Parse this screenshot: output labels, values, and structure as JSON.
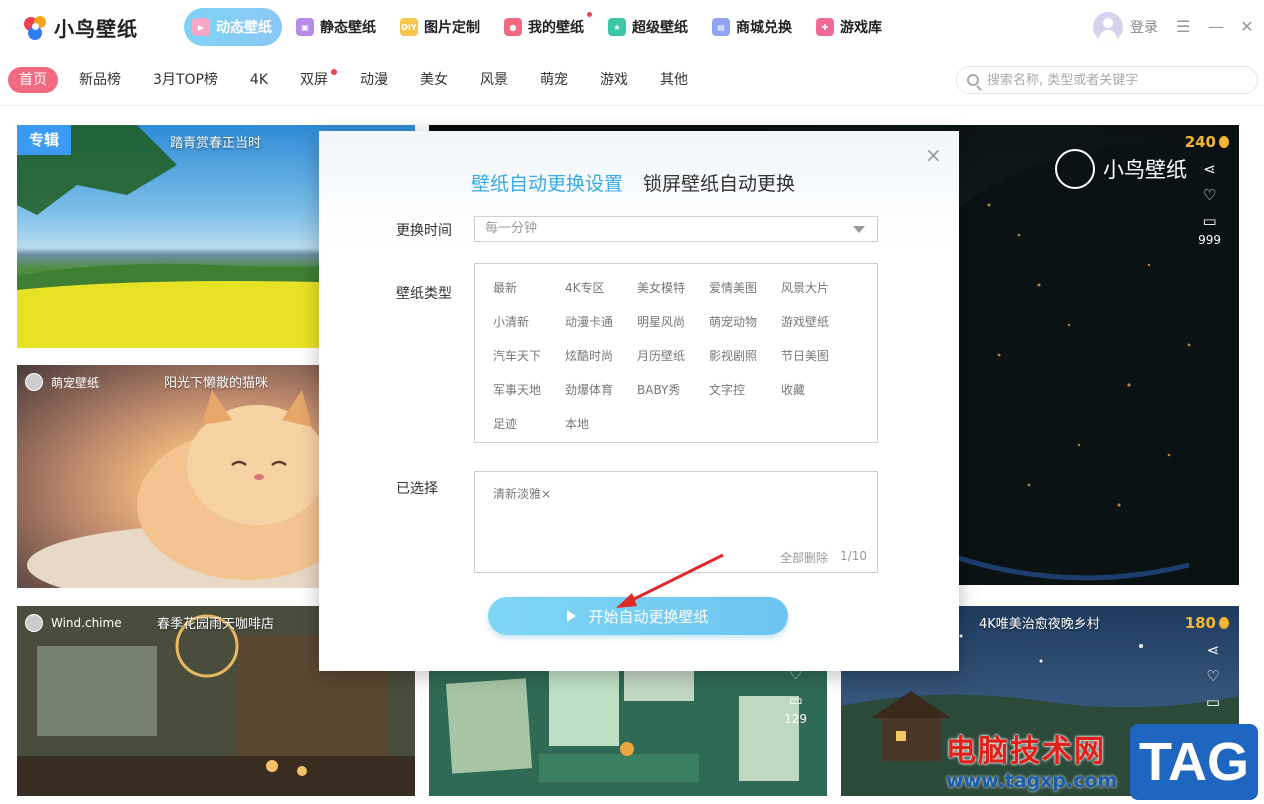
{
  "app": {
    "logo_text": "小鸟壁纸"
  },
  "nav": {
    "items": [
      {
        "label": "动态壁纸",
        "icon": "play-icon",
        "color": "#f16a7f"
      },
      {
        "label": "静态壁纸",
        "icon": "image-icon",
        "color": "#b78be8"
      },
      {
        "label": "图片定制",
        "icon": "diy-icon",
        "color": "#f5c64b"
      },
      {
        "label": "我的壁纸",
        "icon": "user-icon",
        "color": "#f16a7f"
      },
      {
        "label": "超级壁纸",
        "icon": "star-icon",
        "color": "#3cc6a8"
      },
      {
        "label": "商城兑换",
        "icon": "shop-icon",
        "color": "#8fa5f2"
      },
      {
        "label": "游戏库",
        "icon": "gamepad-icon",
        "color": "#f16a9a"
      }
    ],
    "active_index": 0
  },
  "user": {
    "login_label": "登录"
  },
  "categories": {
    "items": [
      "首页",
      "新品榜",
      "3月TOP榜",
      "4K",
      "双屏",
      "动漫",
      "美女",
      "风景",
      "萌宠",
      "游戏",
      "其他"
    ],
    "active_index": 0
  },
  "search": {
    "placeholder": "搜索名称, 类型或者关键字"
  },
  "cards": {
    "c1": {
      "badge": "专辑",
      "title": "踏青赏春正当时"
    },
    "c2": {
      "user": "萌宠壁纸",
      "title": "阳光下懒散的猫咪"
    },
    "c3": {
      "user": "Wind.chime",
      "title": "春季花园雨天咖啡店"
    },
    "c4": {
      "count": "129"
    },
    "c5": {
      "title": "4K唯美治愈夜晚乡村",
      "coins": "180"
    },
    "space": {
      "brand": "小鸟壁纸",
      "coins": "240",
      "comments": "999"
    }
  },
  "dialog": {
    "tab_active": "壁纸自动更换设置",
    "tab_other": "锁屏壁纸自动更换",
    "interval_label": "更换时间",
    "interval_value": "每一分钟",
    "types_label": "壁纸类型",
    "types": [
      "最新",
      "4K专区",
      "美女模特",
      "爱情美图",
      "风景大片",
      "小清新",
      "动漫卡通",
      "明星风尚",
      "萌宠动物",
      "游戏壁纸",
      "汽车天下",
      "炫酷时尚",
      "月历壁纸",
      "影视剧照",
      "节日美图",
      "军事天地",
      "劲爆体育",
      "BABY秀",
      "文字控",
      "收藏",
      "足迹",
      "本地"
    ],
    "selected_label": "已选择",
    "selected_chip": "清新淡雅×",
    "clear_all": "全部删除",
    "selected_count": "1/10",
    "start_button": "开始自动更换壁纸"
  },
  "watermark": {
    "text": "电脑技术网",
    "url": "www.tagxp.com",
    "tag": "TAG"
  }
}
